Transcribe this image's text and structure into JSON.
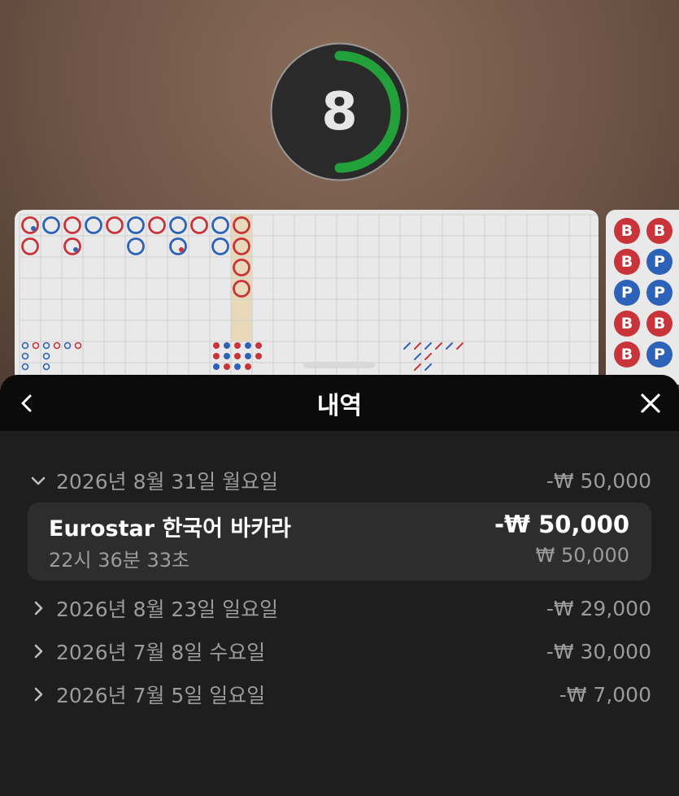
{
  "timer": {
    "value": "8",
    "progress": 0.5
  },
  "colors": {
    "banker": "#c8343a",
    "player": "#2d62b9",
    "timer_ring": "#22a03a"
  },
  "side_road": [
    {
      "label": "B",
      "type": "banker"
    },
    {
      "label": "B",
      "type": "banker"
    },
    {
      "label": "B",
      "type": "banker"
    },
    {
      "label": "P",
      "type": "player"
    },
    {
      "label": "P",
      "type": "player"
    },
    {
      "label": "P",
      "type": "player"
    },
    {
      "label": "B",
      "type": "banker"
    },
    {
      "label": "B",
      "type": "banker"
    },
    {
      "label": "B",
      "type": "banker"
    },
    {
      "label": "P",
      "type": "player"
    }
  ],
  "history": {
    "title": "내역",
    "back_icon": "chevron-left-icon",
    "close_icon": "close-icon",
    "days": [
      {
        "date": "2026년 8월 31일 월요일",
        "amount": "-₩ 50,000",
        "expanded": true
      },
      {
        "date": "2026년 8월 23일 일요일",
        "amount": "-₩ 29,000",
        "expanded": false
      },
      {
        "date": "2026년 7월 8일 수요일",
        "amount": "-₩ 30,000",
        "expanded": false
      },
      {
        "date": "2026년 7월 5일 일요일",
        "amount": "-₩ 7,000",
        "expanded": false
      }
    ],
    "transaction": {
      "game": "Eurostar 한국어 바카라",
      "time": "22시 36분 33초",
      "amount": "-₩ 50,000",
      "bet": "₩ 50,000"
    }
  }
}
